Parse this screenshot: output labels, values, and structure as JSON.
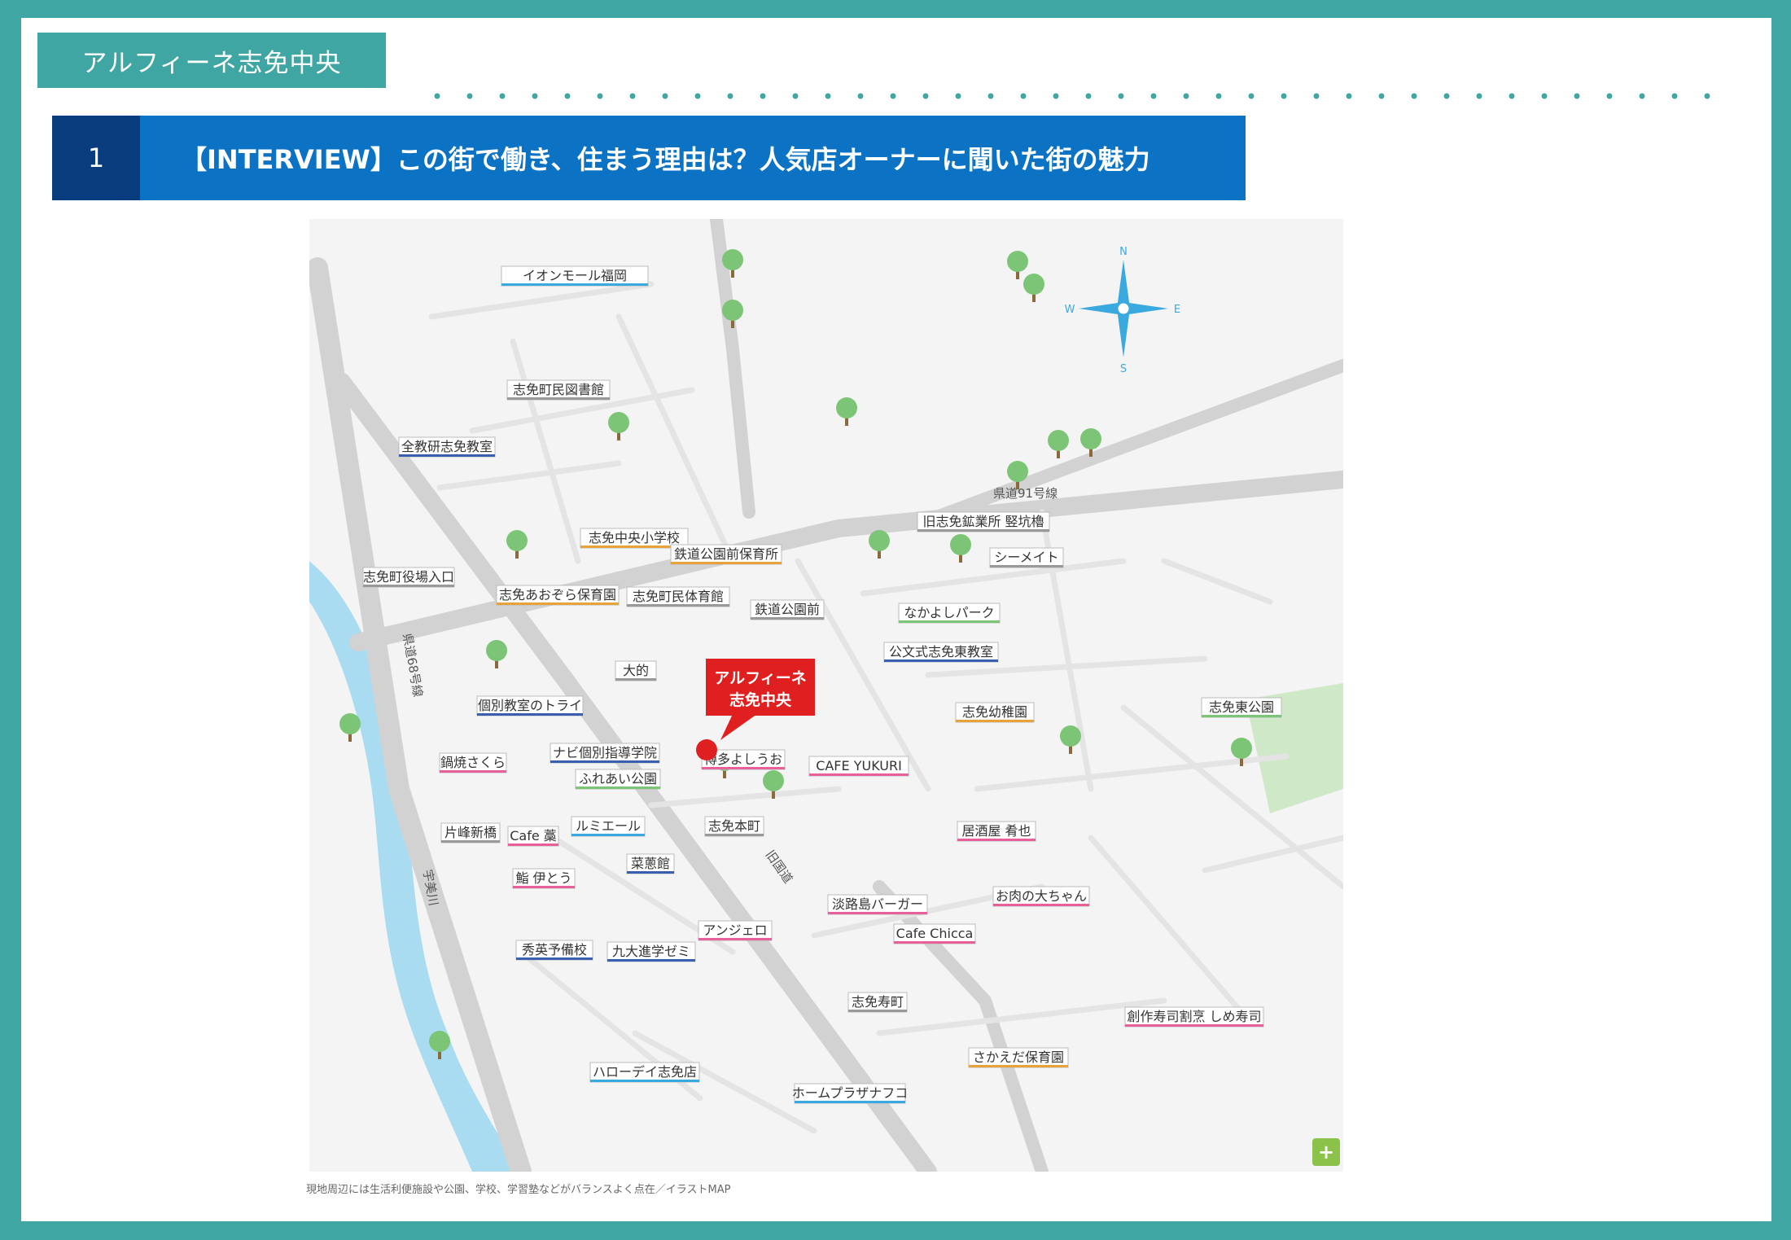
{
  "tag": {
    "label": "アルフィーネ志免中央"
  },
  "header": {
    "number": "1",
    "title": "【INTERVIEW】この街で働き、住まう理由は？人気店オーナーに聞いた街の魅力"
  },
  "map": {
    "caption": "現地周辺には生活利便施設や公園、学校、学習塾などがバランスよく点在／イラストMAP",
    "highlight": {
      "line1": "アルフィーネ",
      "line2": "志免中央"
    },
    "labels": {
      "aeon": "イオンモール福岡",
      "library": "志免町民図書館",
      "zenkyoken": "全教研志免教室",
      "town_office": "志免町役場入口",
      "shime_chuo_school": "志免中央小学校",
      "tetsudo_hoiku": "鉄道公園前保育所",
      "aozora_hoiku": "志免あおぞら保育園",
      "gymnasium": "志免町民体育館",
      "tetsudo_koen": "鉄道公園前",
      "kyu_kogyosho": "旧志免鉱業所 竪坑櫓",
      "seamate": "シーメイト",
      "nakayoshi": "なかよしパーク",
      "ken91": "県道91号線",
      "ohmagari": "大的",
      "kumon": "公文式志免東教室",
      "kobetsu_tri": "個別教室のトライ",
      "navi": "ナビ個別指導学院",
      "fureai": "ふれあい公園",
      "hakata_yoshiuo": "博多よしうお",
      "kindergarten": "志免幼稚園",
      "higashi_koen": "志免東公園",
      "nabe_sakura": "鍋焼さくら",
      "cafe_yukuri": "CAFE YUKURI",
      "katamine": "片峰新橋",
      "cafe_mame": "Cafe 藁",
      "lumiere": "ルミエール",
      "shimehonmachi": "志免本町",
      "kayakan": "菜蔥館",
      "izakaya": "居酒屋 肴也",
      "sushi_ito": "鮨 伊とう",
      "awaji": "淡路島バーガー",
      "oniku": "お肉の大ちゃん",
      "angelo": "アンジェロ",
      "cafe_chicca": "Cafe Chicca",
      "shuei": "秀英予備校",
      "kyudai": "九大進学ゼミ",
      "shimekotobuki": "志免寿町",
      "shime_sushi": "創作寿司割烹 しめ寿司",
      "haloday": "ハローデイ志免店",
      "home_plaza": "ホームプラザナフコ",
      "sakaeda": "さかえだ保育園",
      "umi_river": "宇美川",
      "kenpo": "県道68号線",
      "road_b": "旧国道"
    },
    "compass": {
      "n": "N",
      "e": "E",
      "s": "S",
      "w": "W"
    }
  },
  "zoom": {
    "label": "+"
  },
  "colors": {
    "teal": "#3fa6a3",
    "navy": "#0a3d7d",
    "blue": "#0b72c4",
    "red": "#e02020"
  }
}
